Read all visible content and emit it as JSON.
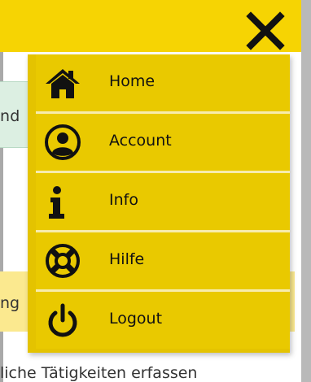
{
  "menu": {
    "items": [
      {
        "label": "Home",
        "icon": "home-icon"
      },
      {
        "label": "Account",
        "icon": "account-icon"
      },
      {
        "label": "Info",
        "icon": "info-icon"
      },
      {
        "label": "Hilfe",
        "icon": "lifebuoy-icon"
      },
      {
        "label": "Logout",
        "icon": "power-icon"
      }
    ]
  },
  "background": {
    "green_partial": "nd",
    "yellow_partial": "ng",
    "bottom_partial": "liche Tätigkeiten erfassen"
  },
  "colors": {
    "header": "#f6d403",
    "menu": "#e9c900",
    "separator": "#f7ecad",
    "green_field": "#dcefe2",
    "yellow_field": "#fbe98f"
  }
}
